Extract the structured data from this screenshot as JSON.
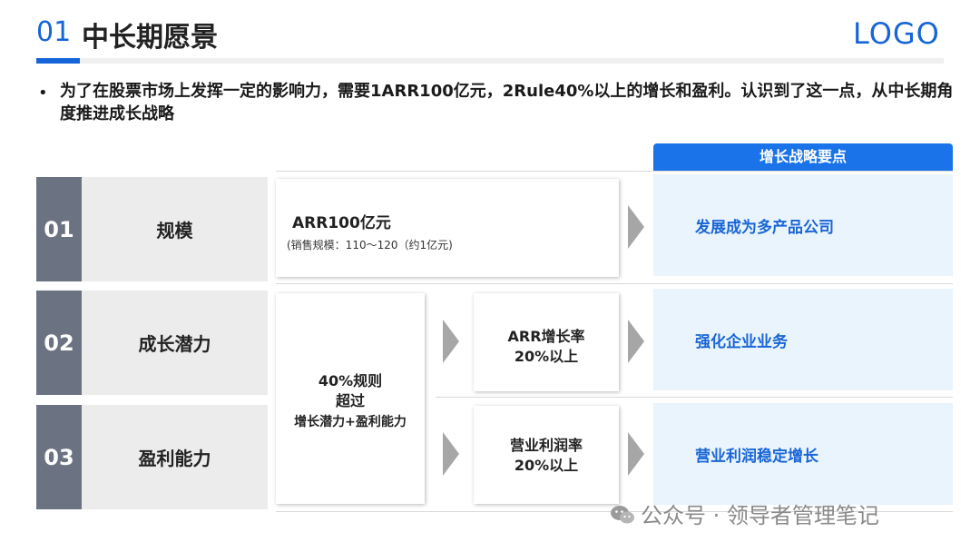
{
  "header": {
    "number": "01",
    "title": "中长期愿景",
    "logo": "LOGO"
  },
  "intro": {
    "bullet": "•",
    "text": "为了在股票市场上发挥一定的影响力，需要1ARR100亿元，2Rule40%以上的增长和盈利。认识到了这一点，从中长期角度推进成长战略"
  },
  "strategy_header": "增长战略要点",
  "rows": [
    {
      "number": "01",
      "label": "规模"
    },
    {
      "number": "02",
      "label": "成长潜力"
    },
    {
      "number": "03",
      "label": "盈利能力"
    }
  ],
  "arr": {
    "title": "ARR100亿元",
    "sub": "(销售规模：110～120（约1亿元)"
  },
  "rule40": {
    "line1": "40%规则",
    "line2": "超过",
    "line3": "增长潜力+盈利能力"
  },
  "growth_rate": {
    "line1": "ARR增长率",
    "line2": "20%以上"
  },
  "profit_rate": {
    "line1": "营业利润率",
    "line2": "20%以上"
  },
  "strategies": [
    "发展成为多产品公司",
    "强化企业业务",
    "营业利润稳定增长"
  ],
  "watermark": {
    "text": "公众号 · 领导者管理笔记",
    "icon": "wechat-icon"
  }
}
